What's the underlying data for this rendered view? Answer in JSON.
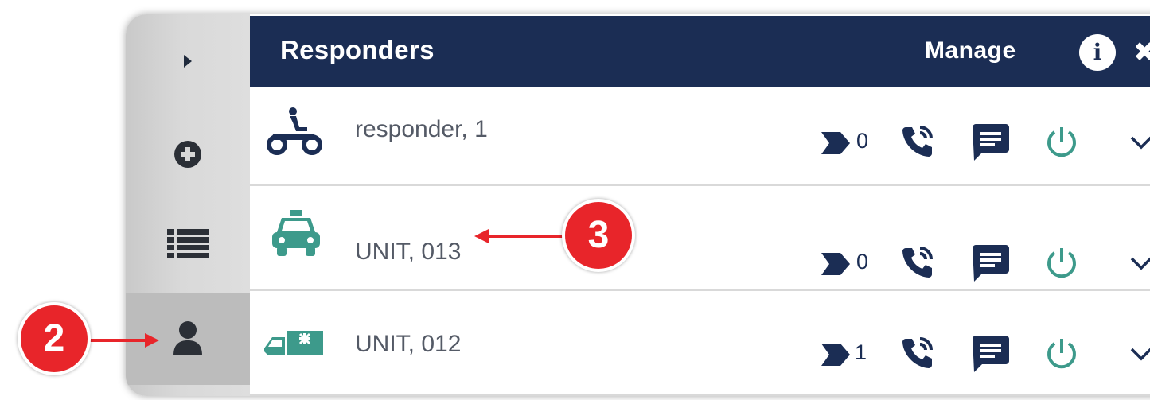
{
  "header": {
    "title": "Responders",
    "manage_label": "Manage",
    "info_icon": "i"
  },
  "sidebar": {
    "items": [
      {
        "name": "expand",
        "icon": "caret-right-icon"
      },
      {
        "name": "add",
        "icon": "plus-circle-icon"
      },
      {
        "name": "list",
        "icon": "list-icon"
      },
      {
        "name": "responders",
        "icon": "user-icon",
        "active": true
      }
    ]
  },
  "responders": [
    {
      "name": "responder, 1",
      "type": "motorcycle-icon",
      "count": "0",
      "icon_color": "#1b2d54"
    },
    {
      "name": "UNIT, 013",
      "type": "car-icon",
      "count": "0",
      "icon_color": "#3d9a8b"
    },
    {
      "name": "UNIT, 012",
      "type": "ambulance-icon",
      "count": "1",
      "icon_color": "#3d9a8b"
    }
  ],
  "annotations": [
    {
      "label": "2"
    },
    {
      "label": "3"
    }
  ],
  "colors": {
    "navy": "#1b2d54",
    "teal": "#3d9a8b",
    "callout_red": "#e8252a",
    "arrow_red": "#e8252a"
  }
}
